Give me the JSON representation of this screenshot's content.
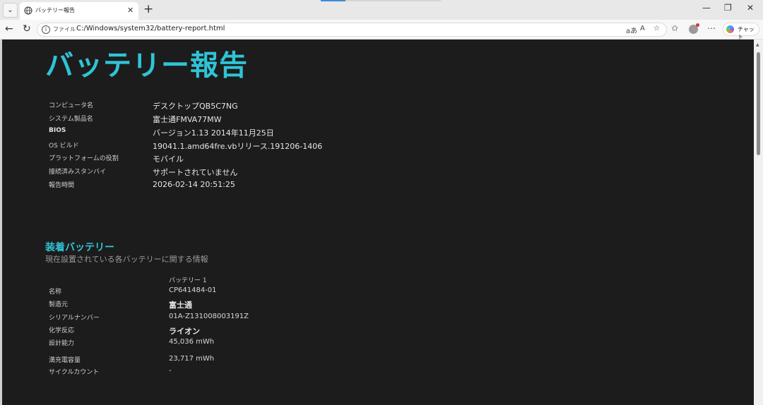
{
  "browser": {
    "tab_title": "バッテリー報告",
    "address_scheme": "ファイル",
    "address_url": "C:/Windows/system32/battery-report.html",
    "copilot_label": "チャット",
    "read_aloud_label": "aあ",
    "read_aloud_a": "A"
  },
  "report": {
    "title": "バッテリー報告",
    "system_info": [
      {
        "label": "コンピュータ名",
        "value": "デスクトップQB5C7NG"
      },
      {
        "label": "システム製品名",
        "value": "富士通FMVA77MW"
      },
      {
        "label": "BIOS",
        "value": "バージョン1.13 2014年11月25日"
      },
      {
        "label": "OS ビルド",
        "value": "19041.1.amd64fre.vbリリース.191206-1406"
      },
      {
        "label": "プラットフォームの役割",
        "value": "モバイル"
      },
      {
        "label": "接続済みスタンバイ",
        "value": "サポートされていません"
      },
      {
        "label": "報告時間",
        "value": "2026-02-14  20:51:25"
      }
    ],
    "installed": {
      "title": "装着バッテリー",
      "subtitle": "現在設置されている各バッテリーに関する情報",
      "column_header": "バッテリー 1",
      "rows": [
        {
          "label": "名称",
          "value": "CP641484-01"
        },
        {
          "label": "製造元",
          "value": "富士通"
        },
        {
          "label": "シリアルナンバー",
          "value": "01A-Z131008003191Z"
        },
        {
          "label": "化学反応",
          "value": "ライオン"
        },
        {
          "label": "設計能力",
          "value": "45,036 mWh"
        },
        {
          "label": "満充電容量",
          "value": "23,717 mWh"
        },
        {
          "label": "サイクルカウント",
          "value": "-"
        }
      ]
    }
  }
}
